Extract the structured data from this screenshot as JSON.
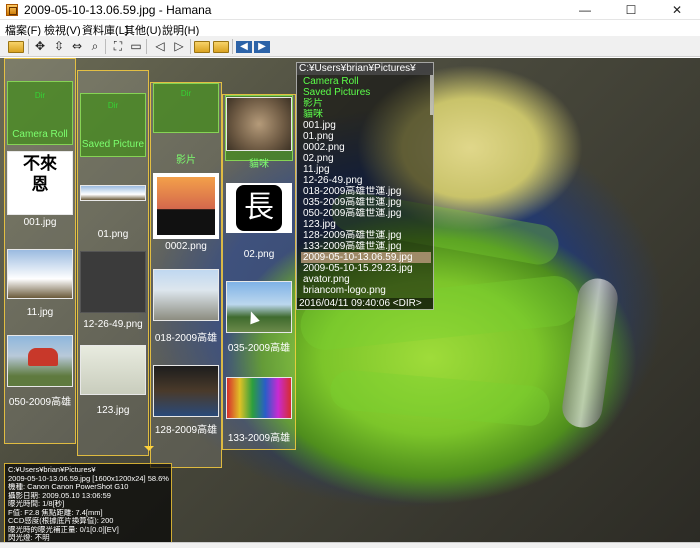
{
  "window": {
    "title": "2009-05-10-13.06.59.jpg - Hamana",
    "min_label": "—",
    "max_label": "☐",
    "close_label": "✕"
  },
  "menu": [
    "檔案(F)",
    "檢視(V)",
    "資料庫(L)",
    "其他(U)",
    "說明(H)"
  ],
  "toolbar": {
    "open_icon": "folder-open-icon",
    "buttons": [
      "✥",
      "⇳",
      "⇔",
      "⌕",
      "⛶",
      "▭",
      "◁",
      "▷",
      "◀",
      "▶"
    ]
  },
  "columns": {
    "col1": {
      "dir_tag": "Dir",
      "dir_label": "Camera Roll",
      "items": [
        {
          "label": "001.jpg",
          "text": "不來\n恩"
        },
        {
          "label": "11.jpg"
        },
        {
          "label": "050-2009高雄"
        }
      ]
    },
    "col2": {
      "dir_tag": "Dir",
      "dir_label": "Saved Picture",
      "items": [
        {
          "label": "01.png"
        },
        {
          "label": "12-26-49.png"
        },
        {
          "label": "123.jpg"
        }
      ]
    },
    "col3": {
      "dir_tag": "Dir",
      "dir_label": "影片",
      "items": [
        {
          "label": "0002.png"
        },
        {
          "label": "018-2009高雄"
        },
        {
          "label": "128-2009高雄"
        }
      ]
    },
    "col4": {
      "items": [
        {
          "label": "貓咪"
        },
        {
          "label": "02.png",
          "glyph": "⾧"
        },
        {
          "label": "035-2009高雄"
        },
        {
          "label": "133-2009高雄"
        }
      ]
    }
  },
  "filelist": {
    "path": "C:¥Users¥brian¥Pictures¥",
    "rows": [
      {
        "name": "Camera Roll",
        "dir": true
      },
      {
        "name": "Saved Pictures",
        "dir": true
      },
      {
        "name": "影片",
        "dir": true
      },
      {
        "name": "貓咪",
        "dir": true
      },
      {
        "name": "001.jpg"
      },
      {
        "name": "01.png"
      },
      {
        "name": "0002.png"
      },
      {
        "name": "02.png"
      },
      {
        "name": "11.jpg"
      },
      {
        "name": "12-26-49.png"
      },
      {
        "name": "018-2009高雄世運.jpg"
      },
      {
        "name": "035-2009高雄世運.jpg"
      },
      {
        "name": "050-2009高雄世運.jpg"
      },
      {
        "name": "123.jpg"
      },
      {
        "name": "128-2009高雄世運.jpg"
      },
      {
        "name": "133-2009高雄世運.jpg"
      },
      {
        "name": "2009-05-10-13.06.59.jpg",
        "selected": true
      },
      {
        "name": "2009-05-10-15.29.23.jpg"
      },
      {
        "name": "avator.png"
      },
      {
        "name": "briancom-logo.png"
      }
    ],
    "footer": "2016/04/11 09:40:06 <DIR>"
  },
  "info": {
    "lines": [
      "C:¥Users¥brian¥Pictures¥",
      "2009-05-10-13.06.59.jpg [1600x1200x24] 58.6%",
      "機種: Canon Canon PowerShot G10",
      "攝影日期: 2009.05.10 13:06:59",
      "曝光時間: 1/8[秒]",
      "F值: F2.8  焦點距離: 7.4[mm]",
      "CCD感度(根據底片換算值): 200",
      "曝光時的曝光補正量: 0/1[0.0][EV]",
      "閃光燈: 不明"
    ]
  }
}
